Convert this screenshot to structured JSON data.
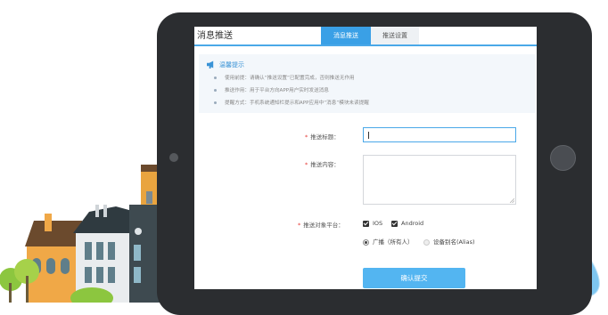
{
  "header": {
    "title": "消息推送"
  },
  "tabs": [
    {
      "label": "消息推送",
      "active": true
    },
    {
      "label": "推送设置",
      "active": false
    }
  ],
  "tips": {
    "title": "温馨提示",
    "items": [
      "使用前提：请确认“推送设置”已配置完成，否则推送无作用",
      "推送作用：用于平台方向APP用户实时发送消息",
      "提醒方式：手机系统通知栏提示和APP应用中“消息”模块未读提醒"
    ]
  },
  "form": {
    "required_mark": "*",
    "title_label": "推送标题：",
    "title_value": "",
    "content_label": "推送内容：",
    "content_value": "",
    "platform_label": "推送对象平台：",
    "platforms": [
      {
        "label": "IOS",
        "checked": true
      },
      {
        "label": "Android",
        "checked": true
      }
    ],
    "targets": [
      {
        "label": "广播（所有人）",
        "selected": true
      },
      {
        "label": "设备别名(Alias)",
        "selected": false
      }
    ],
    "submit_label": "确认提交"
  },
  "colors": {
    "accent": "#3aa0e6",
    "button": "#53b5f1",
    "tablet": "#2b2d30",
    "required": "#e53935"
  }
}
